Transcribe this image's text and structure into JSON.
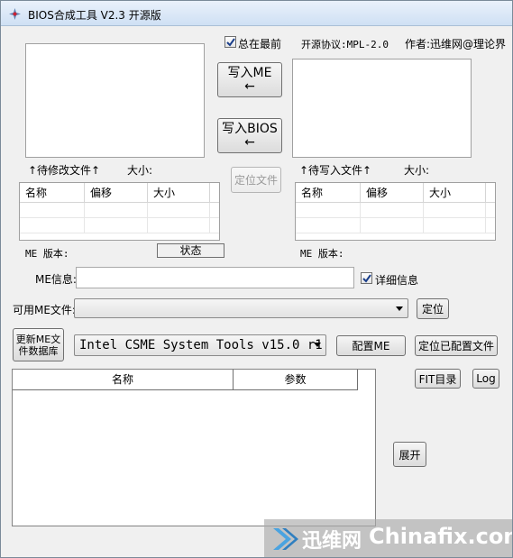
{
  "window": {
    "title": "BIOS合成工具 V2.3 开源版"
  },
  "top": {
    "always_on_top_label": "总在最前",
    "always_on_top_checked": true,
    "license": "开源协议:MPL-2.0",
    "author": "作者:迅维网@理论界"
  },
  "buttons": {
    "write_me": "写入ME",
    "write_bios": "写入BIOS",
    "arrow": "←",
    "locate_file": "定位文件",
    "locate": "定位",
    "update_db_line1": "更新ME文",
    "update_db_line2": "件数据库",
    "config_me": "配置ME",
    "locate_config": "定位已配置文件",
    "fit_dir": "FIT目录",
    "log": "Log",
    "expand": "展开"
  },
  "left_file": {
    "label": "↑待修改文件↑",
    "size_label": "大小:"
  },
  "right_file": {
    "label": "↑待写入文件↑",
    "size_label": "大小:"
  },
  "grid_headers": [
    "名称",
    "偏移",
    "大小"
  ],
  "me_version_label": "ME 版本:",
  "status_label": "状态",
  "me_info_label": "ME信息:",
  "detail_label": "详细信息",
  "detail_checked": true,
  "available_me_label": "可用ME文件:",
  "available_me_value": "",
  "tool_combo_value": "Intel CSME System Tools v15.0 r1",
  "big_table_headers": [
    "名称",
    "参数"
  ],
  "watermark": {
    "cn": "迅维网",
    "en": "Chinafix.com"
  }
}
